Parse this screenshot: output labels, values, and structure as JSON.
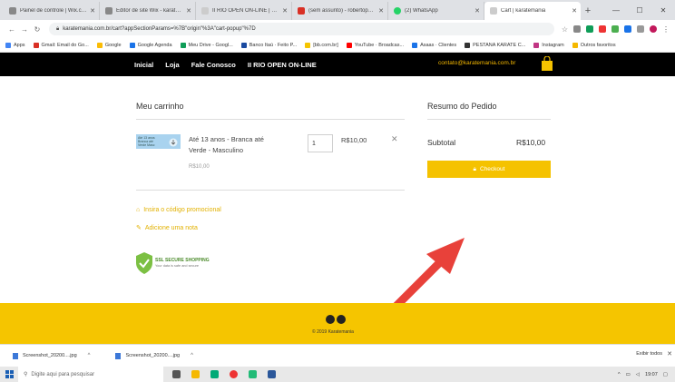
{
  "browser": {
    "tabs": [
      {
        "label": "Painel de controle | Wix.com",
        "favicon_color": "#888888",
        "active": false
      },
      {
        "label": "Editor de site Wix - karatema",
        "favicon_color": "#888888",
        "active": false
      },
      {
        "label": "II RIO OPEN ON-LINE | karat",
        "favicon_color": "#cccccc",
        "active": false
      },
      {
        "label": "(sem assunto) - robertopeiro",
        "favicon_color": "#d93025",
        "active": false
      },
      {
        "label": "(2) WhatsApp",
        "favicon_color": "#25d366",
        "active": false
      },
      {
        "label": "Cart | karatemania",
        "favicon_color": "#cccccc",
        "active": true
      }
    ],
    "new_tab": "+",
    "url": "karatemania.com.br/cart?appSectionParams=%7B\"origin\"%3A\"cart-popup\"%7D",
    "bookmarks": [
      {
        "label": "Apps",
        "color": "#4285f4"
      },
      {
        "label": "Gmail: Email do Go...",
        "color": "#d93025"
      },
      {
        "label": "Google",
        "color": "#fbbc05"
      },
      {
        "label": "Google Agenda",
        "color": "#1a73e8"
      },
      {
        "label": "Meu Drive - Googl...",
        "color": "#0f9d58"
      },
      {
        "label": "Banco Itaú · Feito P...",
        "color": "#1a4aa0"
      },
      {
        "label": "[bb.com.br]",
        "color": "#f5c500"
      },
      {
        "label": "YouTube · Broadcas...",
        "color": "#ff0000"
      },
      {
        "label": "Asaas · Clientes",
        "color": "#1a73e8"
      },
      {
        "label": "PESTANA KARATE C...",
        "color": "#333333"
      },
      {
        "label": "Instagram",
        "color": "#c13584"
      },
      {
        "label": "Outros favoritos",
        "color": "#f5b800"
      }
    ]
  },
  "site": {
    "nav": [
      "Inicial",
      "Loja",
      "Fale Conosco",
      "II RIO OPEN ON-LINE"
    ],
    "email": "contato@karatemania.com.br"
  },
  "cart": {
    "title": "Meu carrinho",
    "item": {
      "name": "Até 13 anos - Branca até Verde - Masculino",
      "thumb_label": "Até 13 anos Branca até Verde Masc",
      "unit_price": "R$10,00",
      "quantity": "1",
      "line_price": "R$10,00"
    },
    "promo_link": "Insira o código promocional",
    "note_link": "Adicione uma nota",
    "ssl": {
      "title": "SSL SECURE SHOPPING",
      "subtitle": "Your data is safe and secure"
    }
  },
  "summary": {
    "title": "Resumo do Pedido",
    "subtotal_label": "Subtotal",
    "subtotal_value": "R$10,00",
    "checkout_label": "Checkout"
  },
  "footer": {
    "copyright": "© 2019 Karatemania"
  },
  "downloads": {
    "items": [
      "Screenshot_20200....jpg",
      "Screenshot_20200....jpg"
    ],
    "show_all": "Exibir todos"
  },
  "taskbar": {
    "search_placeholder": "Digite aqui para pesquisar",
    "time": "19:07"
  },
  "colors": {
    "accent": "#f5c200",
    "header": "#000000",
    "arrow": "#e8413a"
  }
}
